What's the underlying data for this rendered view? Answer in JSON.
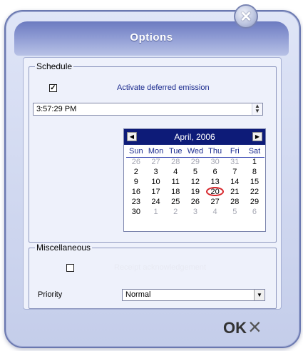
{
  "window": {
    "title": "Options",
    "close_icon": "close-icon"
  },
  "schedule": {
    "group_label": "Schedule",
    "activate_label": "Activate deferred emission",
    "activate_checked": true,
    "time_value": "3:57:29 PM",
    "calendar": {
      "month_label": "April, 2006",
      "weekdays": [
        "Sun",
        "Mon",
        "Tue",
        "Wed",
        "Thu",
        "Fri",
        "Sat"
      ],
      "rows": [
        [
          "26",
          "27",
          "28",
          "29",
          "30",
          "31",
          "1"
        ],
        [
          "2",
          "3",
          "4",
          "5",
          "6",
          "7",
          "8"
        ],
        [
          "9",
          "10",
          "11",
          "12",
          "13",
          "14",
          "15"
        ],
        [
          "16",
          "17",
          "18",
          "19",
          "20",
          "21",
          "22"
        ],
        [
          "23",
          "24",
          "25",
          "26",
          "27",
          "28",
          "29"
        ],
        [
          "30",
          "1",
          "2",
          "3",
          "4",
          "5",
          "6"
        ]
      ],
      "selected_day": "20",
      "today_day": "20"
    }
  },
  "misc": {
    "group_label": "Miscellaneous",
    "receipt_label": "Receipt acknowledgement",
    "receipt_checked": false,
    "priority_label": "Priority",
    "priority_value": "Normal"
  },
  "footer": {
    "ok_label": "OK",
    "cancel_label": "×"
  }
}
